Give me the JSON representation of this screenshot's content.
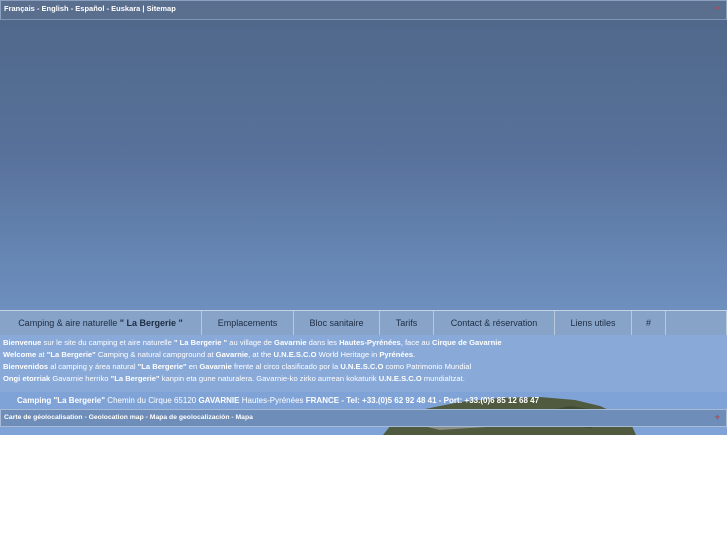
{
  "topbar": {
    "languages": [
      "Français",
      "English",
      "Español",
      "Euskara"
    ],
    "separator": " - ",
    "pipe": " | ",
    "sitemap": "Sitemap",
    "plus": "+"
  },
  "nav": {
    "items": [
      {
        "label_prefix": "Camping & aire naturelle ",
        "label_bold": "\" La Bergerie \""
      },
      {
        "label": "Emplacements"
      },
      {
        "label": "Bloc sanitaire"
      },
      {
        "label": "Tarifs"
      },
      {
        "label": "Contact & réservation"
      },
      {
        "label": "Liens utiles"
      },
      {
        "label": "#"
      },
      {
        "label": ""
      }
    ]
  },
  "welcome": {
    "fr": {
      "p1": "Bienvenue",
      "p2": " sur le site du camping et aire naturelle ",
      "p3": "\" La Bergerie \"",
      "p4": " au village de ",
      "p5": "Gavarnie",
      "p6": " dans les ",
      "p7": "Hautes-Pyrénées",
      "p8": ", face au ",
      "p9": "Cirque de Gavarnie"
    },
    "en": {
      "p1": "Welcome",
      "p2": " at ",
      "p3": "\"La Bergerie\"",
      "p4": " Camping & natural campground at ",
      "p5": "Gavarnie",
      "p6": ", at the ",
      "p7": "U.N.E.S.C.O",
      "p8": " World Heritage in ",
      "p9": "Pyrénées",
      "p10": "."
    },
    "es": {
      "p1": "Bienvenidos",
      "p2": " al camping y área natural ",
      "p3": "\"La Bergerie\"",
      "p4": " en ",
      "p5": "Gavarnie",
      "p6": " frente al circo clasificado por la ",
      "p7": "U.N.E.S.C.O",
      "p8": " como Patrimonio Mundial"
    },
    "eu": {
      "p1": "Ongi etorriak",
      "p2": " Gavarnie herriko ",
      "p3": "\"La Bergerie\"",
      "p4": " kanpin eta gune naturalera. Gavarnie-ko zirko aurrean kokaturik ",
      "p5": "U.N.E.S.C.O",
      "p6": " mundialtzat."
    }
  },
  "address": {
    "p1": "Camping \"La Bergerie\"",
    "p2": " Chemin du Cirque 65120 ",
    "p3": "GAVARNIE",
    "p4": " Hautes-Pyrénées ",
    "p5": "FRANCE - Tel: +33.(0)5 62 92 48 41 - Port: +33.(0)6 85 12 68 47"
  },
  "mapbar": {
    "text": "Carte de géolocalisation - Geolocation map - Mapa de geolocalización - Mapa",
    "plus": "+"
  },
  "colors": {
    "sky_top": "#4f6788",
    "sky_bottom": "#86aee0",
    "nav_bg": "#87a3c8",
    "welcome_bg": "#89a9d8",
    "accent_plus": "#d23b3b"
  }
}
